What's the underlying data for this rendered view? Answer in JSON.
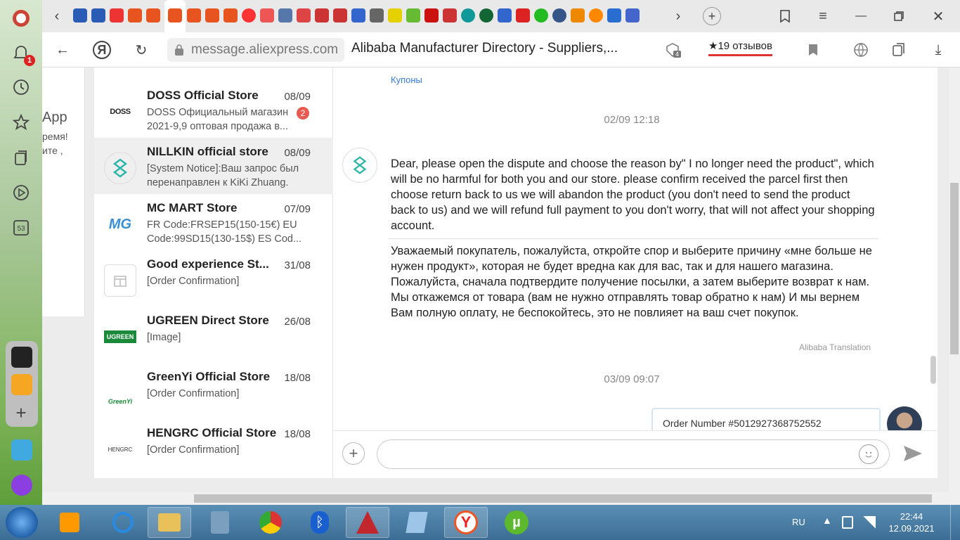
{
  "browser": {
    "url": "message.aliexpress.com",
    "page_title": "Alibaba Manufacturer Directory - Suppliers,...",
    "reviews": "★19 отзывов",
    "notification_count": "1",
    "tabs_count_badge": "4"
  },
  "left_peek": {
    "title": "App",
    "line1": "ремя!",
    "line2": "ите ,"
  },
  "conversations": [
    {
      "name": "DOSS Official Store",
      "date": "08/09",
      "preview": "DOSS Официальный магазин 2021-9,9 оптовая продажа в...",
      "unread": "2",
      "logo": "DOSS"
    },
    {
      "name": "NILLKIN official store",
      "date": "08/09",
      "preview": "[System Notice]:Ваш запрос был перенаправлен к KiKi Zhuang.",
      "logo": "NILLKIN"
    },
    {
      "name": "MC MART Store",
      "date": "07/09",
      "preview": "FR Code:FRSEP15(150-15€) EU Code:99SD15(130-15$) ES Cod...",
      "logo": "MG"
    },
    {
      "name": "Good experience St...",
      "date": "31/08",
      "preview": "[Order Confirmation]",
      "logo": ""
    },
    {
      "name": "UGREEN Direct Store",
      "date": "26/08",
      "preview": "[Image]",
      "logo": "UGREEN"
    },
    {
      "name": "GreenYi Official Store",
      "date": "18/08",
      "preview": "[Order Confirmation]",
      "logo": "GreenYi"
    },
    {
      "name": "HENGRC Official Store",
      "date": "18/08",
      "preview": "[Order Confirmation]",
      "logo": "HENGRC"
    }
  ],
  "chat": {
    "coupon_link": "Купоны",
    "timestamp1": "02/09 12:18",
    "message_en": "Dear, please open the dispute and choose the reason by\" I no longer need the product\", which will be no harmful for both you and our store. please confirm received the parcel first then choose return back to us we will abandon the product (you don't need to send the product back to us) and we will refund full payment to you don't worry, that will not affect your shopping account.",
    "message_ru": "Уважаемый покупатель, пожалуйста, откройте спор и выберите причину «мне больше не нужен продукт», которая не будет вредна как для вас, так и для нашего магазина. Пожалуйста, сначала подтвердите получение посылки, а затем выберите возврат к нам. Мы откажемся от товара (вам не нужно отправлять товар обратно к нам) И мы вернем Вам полную оплату, не беспокойтесь, это не повлияет на ваш счет покупок.",
    "translation_label": "Alibaba Translation",
    "timestamp2": "03/09 09:07",
    "order_number": "Order Number #5012927368752552",
    "input_placeholder": ""
  },
  "taskbar": {
    "lang": "RU",
    "time": "22:44",
    "date": "12.09.2021"
  },
  "colors": {
    "accent_blue": "#3a7bd5",
    "badge_red": "#e85a50",
    "nillkin_teal": "#2bb5a8"
  }
}
